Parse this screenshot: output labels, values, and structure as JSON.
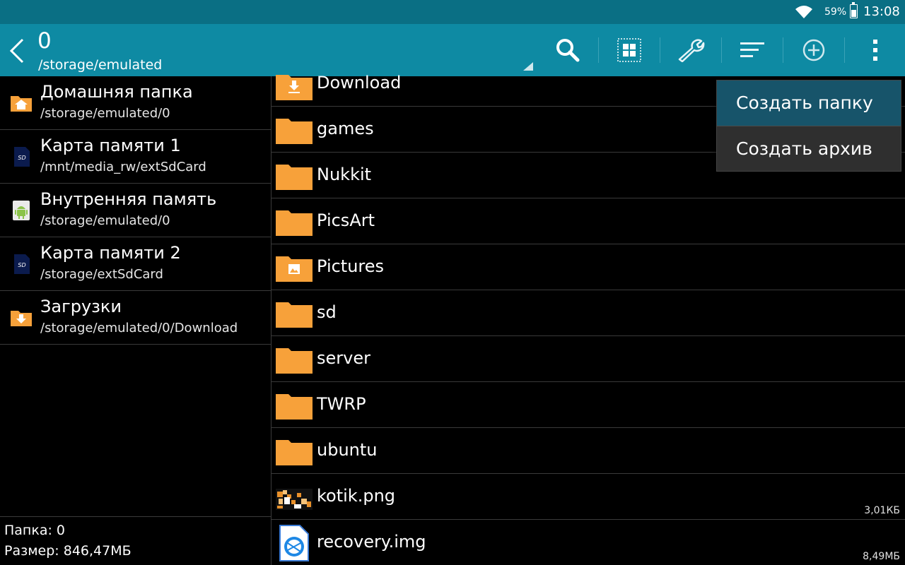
{
  "status_bar": {
    "battery_percent": "59%",
    "time": "13:08"
  },
  "action_bar": {
    "title": "0",
    "subtitle": "/storage/emulated",
    "actions": [
      "search-icon",
      "grid-view-icon",
      "wrench-icon",
      "sort-icon",
      "add-circle-icon",
      "overflow-menu-icon"
    ]
  },
  "locations": [
    {
      "name": "Домашняя папка",
      "path": "/storage/emulated/0",
      "icon": "home-folder-icon"
    },
    {
      "name": "Карта памяти 1",
      "path": "/mnt/media_rw/extSdCard",
      "icon": "sd-card-icon"
    },
    {
      "name": "Внутренняя память",
      "path": "/storage/emulated/0",
      "icon": "android-icon"
    },
    {
      "name": "Карта памяти 2",
      "path": "/storage/extSdCard",
      "icon": "sd-card-icon"
    },
    {
      "name": "Загрузки",
      "path": "/storage/emulated/0/Download",
      "icon": "download-folder-icon"
    }
  ],
  "summary": {
    "folder": "Папка: 0",
    "size": "Размер: 846,47МБ"
  },
  "files": [
    {
      "name": "Download",
      "type": "download-folder",
      "size": ""
    },
    {
      "name": "games",
      "type": "folder",
      "size": ""
    },
    {
      "name": "Nukkit",
      "type": "folder",
      "size": ""
    },
    {
      "name": "PicsArt",
      "type": "folder",
      "size": ""
    },
    {
      "name": "Pictures",
      "type": "pictures-folder",
      "size": ""
    },
    {
      "name": "sd",
      "type": "folder",
      "size": ""
    },
    {
      "name": "server",
      "type": "folder",
      "size": ""
    },
    {
      "name": "TWRP",
      "type": "folder",
      "size": ""
    },
    {
      "name": "ubuntu",
      "type": "folder",
      "size": ""
    },
    {
      "name": "kotik.png",
      "type": "image-file",
      "size": "3,01КБ"
    },
    {
      "name": "recovery.img",
      "type": "disk-image-file",
      "size": "8,49МБ"
    }
  ],
  "popup_menu": {
    "items": [
      "Создать папку",
      "Создать архив"
    ]
  },
  "colors": {
    "status_bar": "#0a6f84",
    "action_bar": "#0e8aa3",
    "folder": "#f7a13a",
    "menu_selected": "#17546a"
  }
}
